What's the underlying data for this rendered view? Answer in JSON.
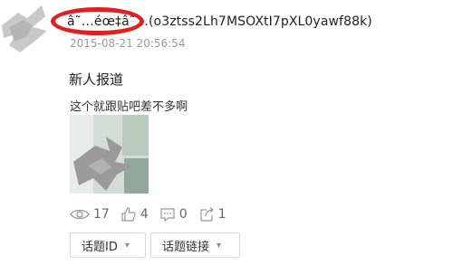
{
  "post": {
    "username": "â˜…éœ‡â˜…(o3ztss2Lh7MSOXtI7pXL0yawf88k)",
    "timestamp": "2015-08-21 20:56:54",
    "title": "新人报道",
    "body": "这个就跟贴吧差不多啊"
  },
  "stats": {
    "views": "17",
    "likes": "4",
    "comments": "0",
    "shares": "1"
  },
  "buttons": {
    "topic_id": "话题ID",
    "topic_link": "话题链接"
  },
  "icons": {
    "views": "eye-icon",
    "likes": "thumbs-up-icon",
    "comments": "comment-icon",
    "shares": "share-icon",
    "dropdown": "chevron-down-icon"
  },
  "colors": {
    "highlight_ring": "#e01f1f",
    "timestamp_text": "#9b9b9b"
  }
}
